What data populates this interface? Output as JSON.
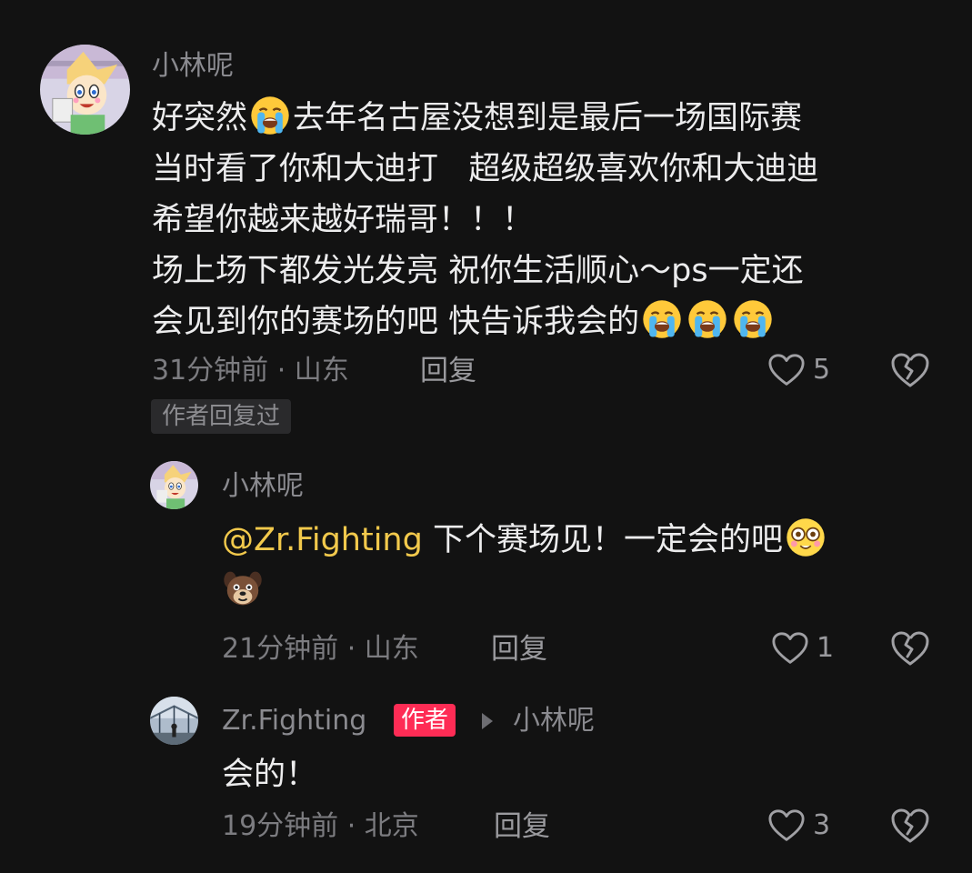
{
  "comment": {
    "username": "小林呢",
    "lines": [
      [
        "好突然",
        "😭",
        "去年名古屋没想到是最后一场国际赛"
      ],
      [
        "当时看了你和大迪打   超级超级喜欢你和大迪迪"
      ],
      [
        "希望你越来越好瑞哥！！！"
      ],
      [
        "场上场下都发光发亮 祝你生活顺心～ps一定还"
      ],
      [
        "会见到你的赛场的吧 快告诉我会的",
        "😭",
        "😭",
        "😭"
      ]
    ],
    "meta": "31分钟前 · 山东",
    "reply_label": "回复",
    "like_count": "5",
    "author_replied_tag": "作者回复过"
  },
  "reply1": {
    "username": "小林呢",
    "mention": "@Zr.Fighting",
    "text": " 下个赛场见！一定会的吧",
    "emoji1": "😳",
    "emoji2": "🐶",
    "meta": "21分钟前 · 山东",
    "reply_label": "回复",
    "like_count": "1"
  },
  "reply2": {
    "username": "Zr.Fighting",
    "author_badge": "作者",
    "reply_to": "小林呢",
    "text": "会的！",
    "meta": "19分钟前 · 北京",
    "reply_label": "回复",
    "like_count": "3"
  },
  "icons": {
    "like": "heart-outline-icon",
    "dislike": "broken-heart-icon",
    "crying_emoji": "loudly-crying-face-emoji",
    "flushed_emoji": "flushed-face-emoji",
    "dog_emoji": "dog-face-emoji"
  },
  "colors": {
    "background": "#121212",
    "username": "#8a8a8f",
    "text": "#ececed",
    "mention": "#f2c94c",
    "author_badge": "#fe2c55"
  }
}
